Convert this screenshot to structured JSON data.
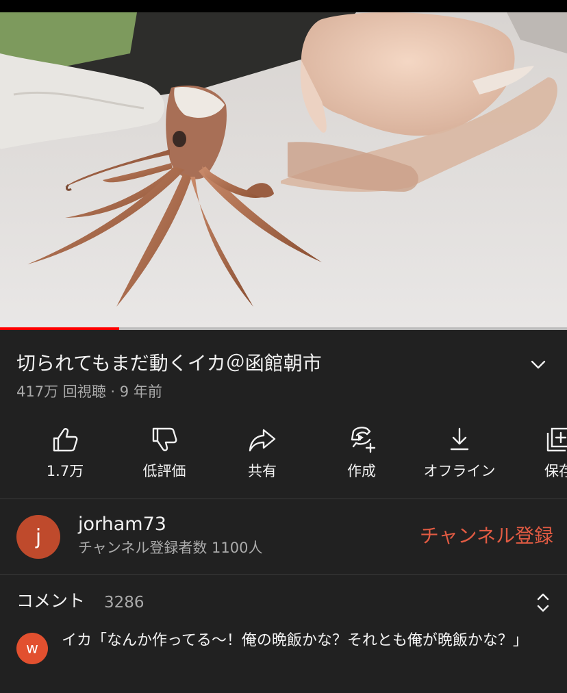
{
  "video": {
    "title": "切られてもまだ動くイカ＠函館朝市",
    "meta": "417万 回視聴 · 9 年前",
    "progress_fraction": 0.21
  },
  "actions": [
    {
      "label": "1.7万",
      "icon": "thumbs-up-icon"
    },
    {
      "label": "低評価",
      "icon": "thumbs-down-icon"
    },
    {
      "label": "共有",
      "icon": "share-icon"
    },
    {
      "label": "作成",
      "icon": "create-icon"
    },
    {
      "label": "オフライン",
      "icon": "download-icon"
    },
    {
      "label": "保存",
      "icon": "save-icon"
    }
  ],
  "channel": {
    "avatar_letter": "j",
    "avatar_color": "#bf4a2c",
    "name": "jorham73",
    "subscribers": "チャンネル登録者数 1100人",
    "subscribe_label": "チャンネル登録",
    "subscribe_color": "#e25b43"
  },
  "comments": {
    "heading": "コメント",
    "count": "3286",
    "top_comment": {
      "avatar_letter": "w",
      "avatar_color": "#e2502f",
      "text": "イカ「なんか作ってる〜！俺の晩飯かな？それとも俺が晩飯かな？」"
    }
  },
  "colors": {
    "background": "#212121",
    "progress": "#ff0000"
  }
}
